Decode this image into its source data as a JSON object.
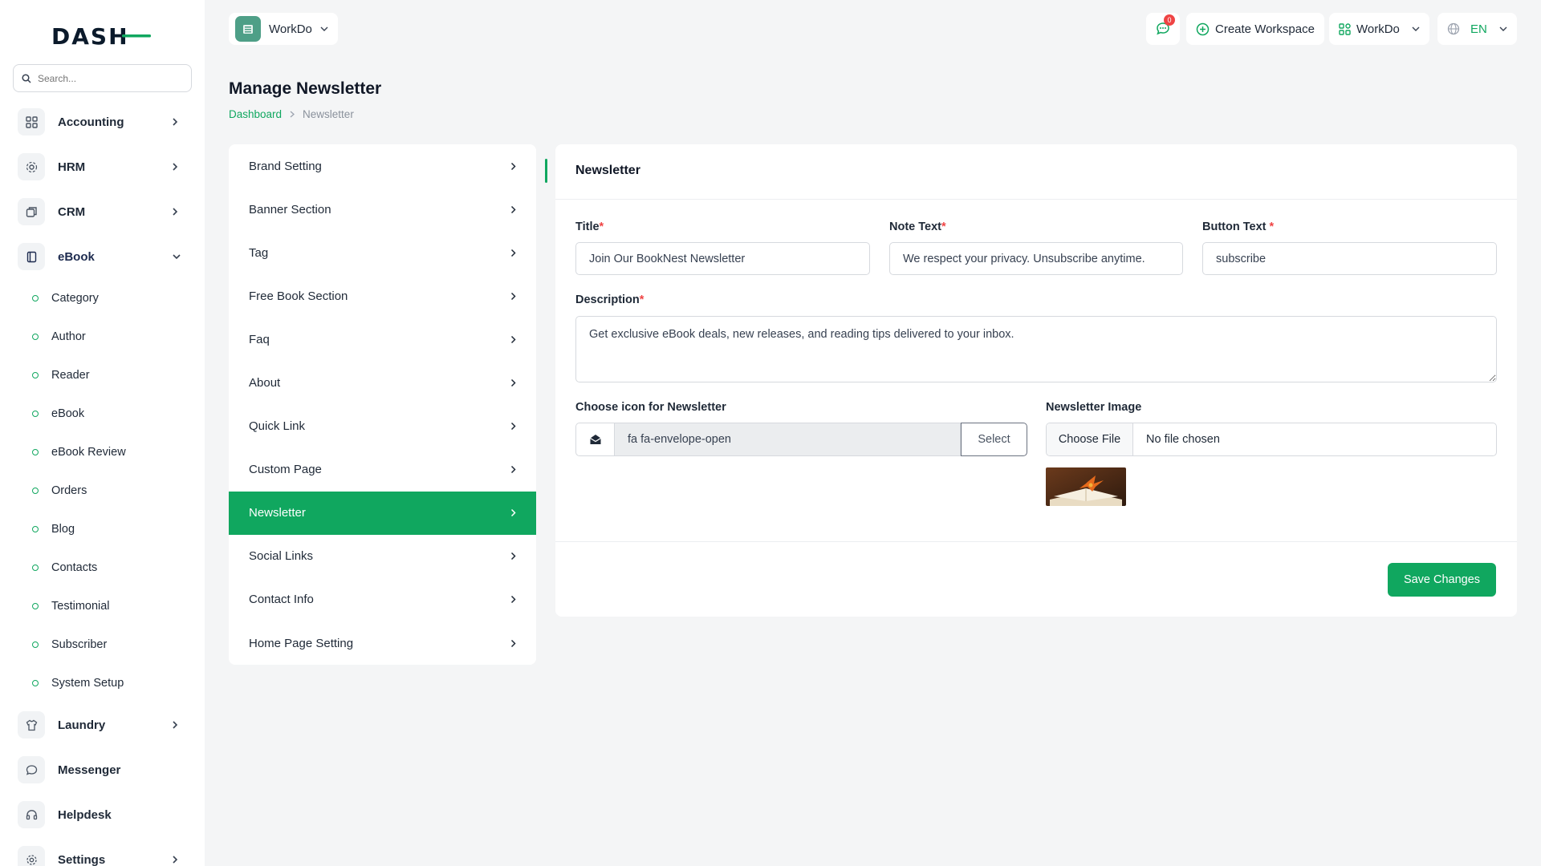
{
  "brand": {
    "logo_text": "DASH",
    "accent_color": "#10a75f"
  },
  "search": {
    "placeholder": "Search..."
  },
  "sidebar": {
    "items": [
      {
        "label": "Accounting",
        "icon": "grid-icon"
      },
      {
        "label": "HRM",
        "icon": "hrm-icon"
      },
      {
        "label": "CRM",
        "icon": "crm-icon"
      },
      {
        "label": "eBook",
        "icon": "book-icon",
        "expanded": true
      }
    ],
    "sub_items": [
      "Category",
      "Author",
      "Reader",
      "eBook",
      "eBook Review",
      "Orders",
      "Blog",
      "Contacts",
      "Testimonial",
      "Subscriber",
      "System Setup"
    ],
    "bottom_items": [
      {
        "label": "Laundry",
        "icon": "shirt-icon"
      },
      {
        "label": "Messenger",
        "icon": "chat-icon"
      },
      {
        "label": "Helpdesk",
        "icon": "headset-icon"
      },
      {
        "label": "Settings",
        "icon": "gear-icon"
      }
    ]
  },
  "header": {
    "workspace": "WorkDo",
    "notification_count": "0",
    "create_workspace": "Create Workspace",
    "user": "WorkDo",
    "language": "EN"
  },
  "page": {
    "title": "Manage Newsletter",
    "breadcrumb_home": "Dashboard",
    "breadcrumb_current": "Newsletter"
  },
  "settings_menu": [
    "Brand Setting",
    "Banner Section",
    "Tag",
    "Free Book Section",
    "Faq",
    "About",
    "Quick Link",
    "Custom Page",
    "Newsletter",
    "Social Links",
    "Contact Info",
    "Home Page Setting"
  ],
  "form": {
    "card_title": "Newsletter",
    "title_label": "Title",
    "title_value": "Join Our BookNest Newsletter",
    "note_label": "Note Text",
    "note_value": "We respect your privacy. Unsubscribe anytime.",
    "button_label": "Button Text ",
    "button_value": "subscribe",
    "description_label": "Description",
    "description_value": "Get exclusive eBook deals, new releases, and reading tips delivered to your inbox.",
    "icon_label": "Choose icon for Newsletter",
    "icon_value": "fa fa-envelope-open",
    "select_label": "Select",
    "image_label": "Newsletter Image",
    "choose_file": "Choose File",
    "no_file": "No file chosen",
    "save_label": "Save Changes"
  }
}
